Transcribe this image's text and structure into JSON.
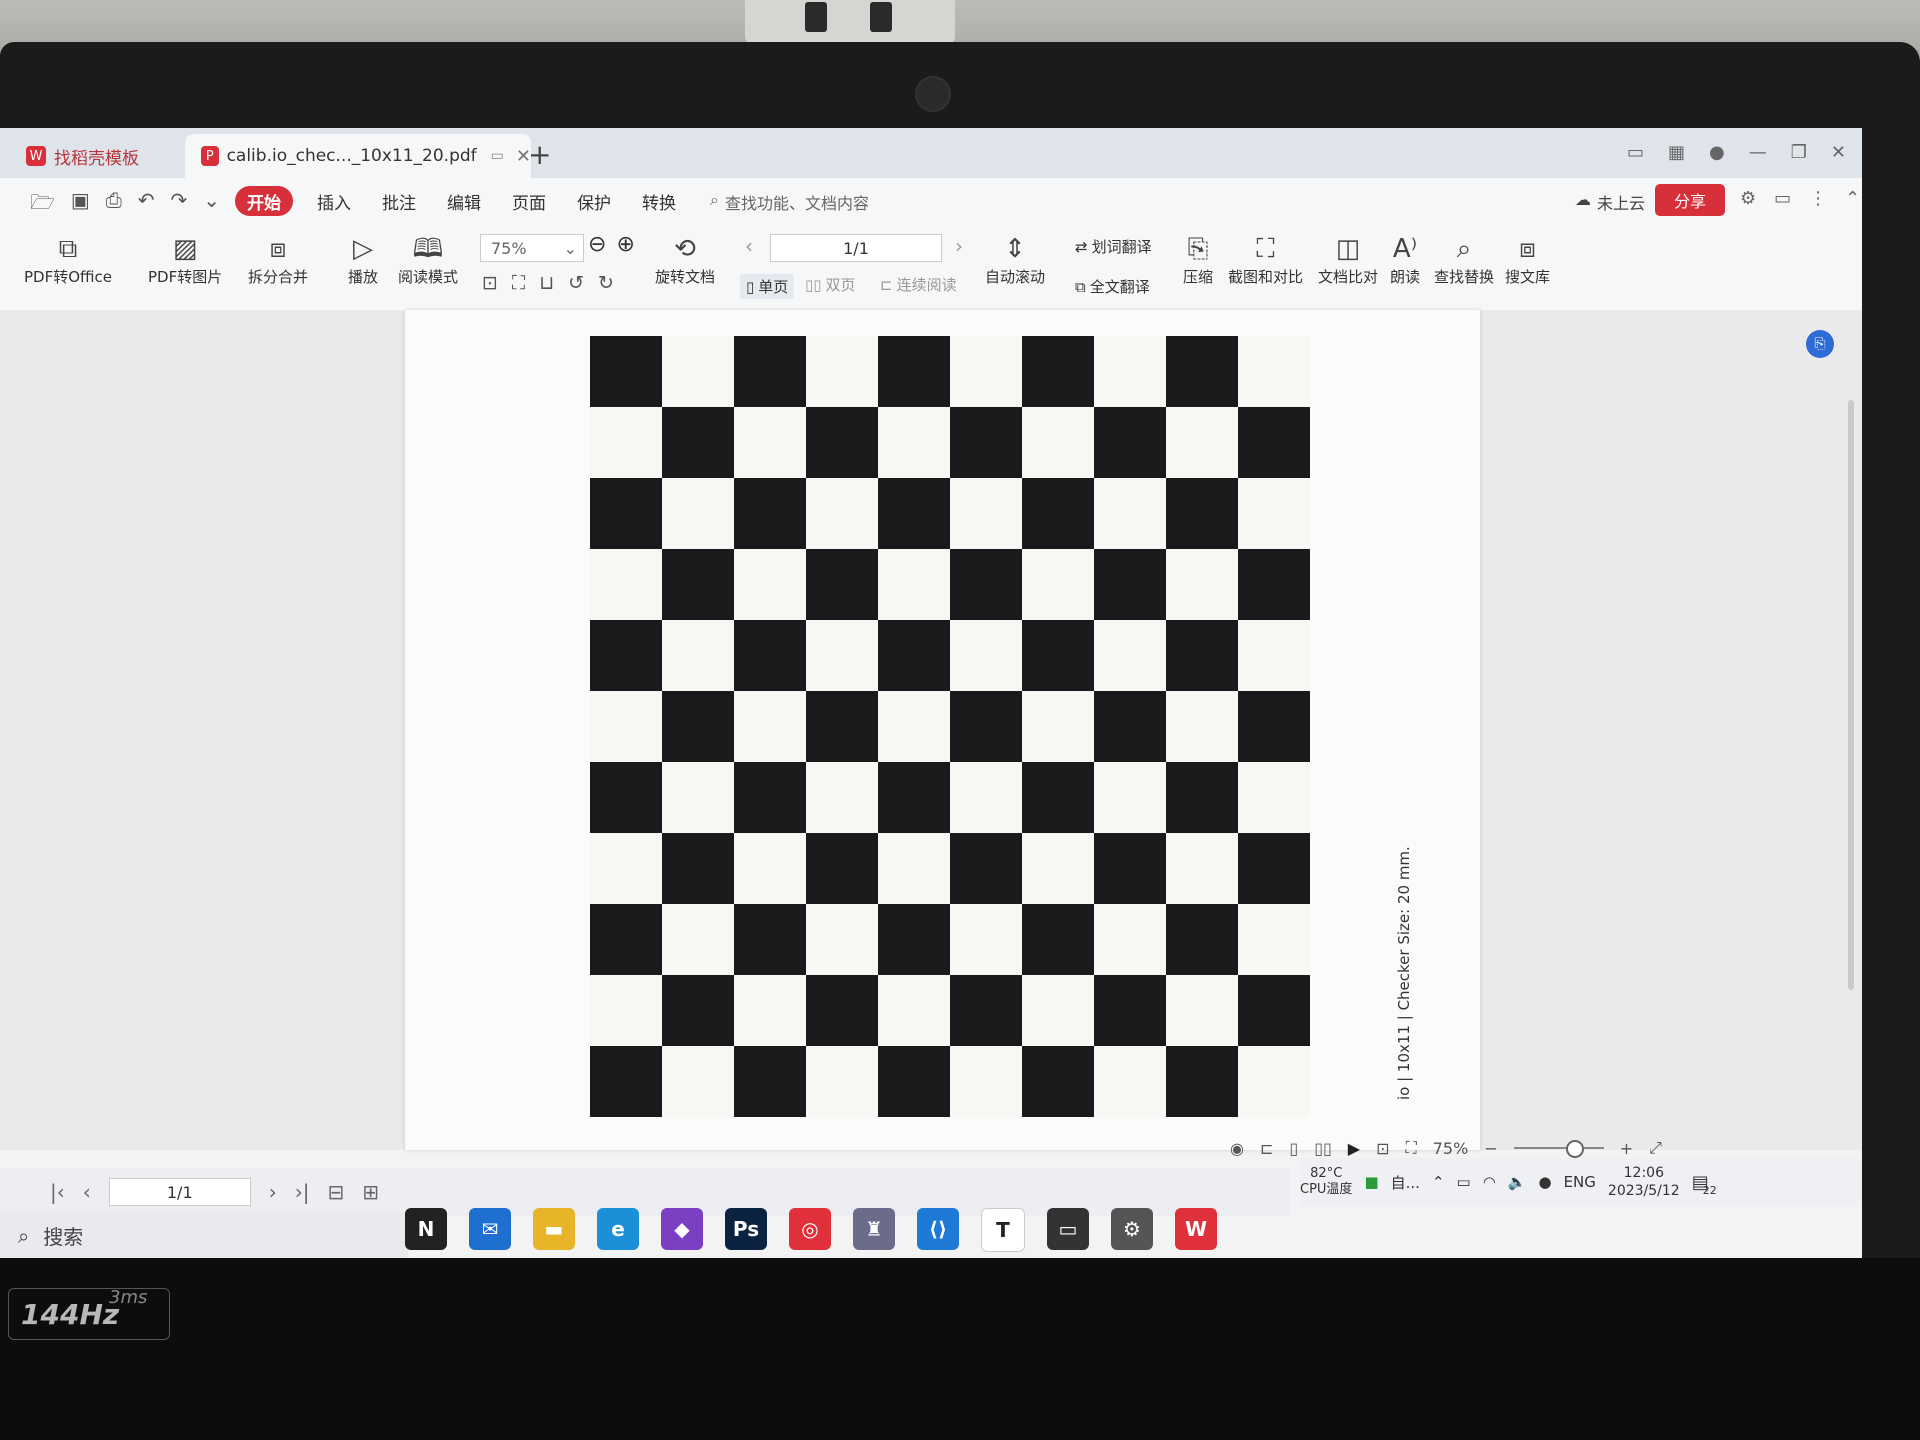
{
  "tabs": {
    "inactive": "找稻壳模板",
    "active": "calib.io_chec..._10x11_20.pdf",
    "add": "+"
  },
  "menu": {
    "items": [
      "开始",
      "插入",
      "批注",
      "编辑",
      "页面",
      "保护",
      "转换"
    ],
    "active": "开始",
    "search_placeholder": "查找功能、文档内容",
    "cloud_label": "未上云",
    "share_label": "分享"
  },
  "ribbon": {
    "pdf_to_office": "PDF转Office",
    "pdf_to_image": "PDF转图片",
    "split_merge": "拆分合并",
    "play": "播放",
    "read_mode": "阅读模式",
    "zoom": "75%",
    "page_indicator": "1/1",
    "rotate_doc": "旋转文档",
    "single_page": "单页",
    "double_page": "双页",
    "continuous_read": "连续阅读",
    "auto_scroll": "自动滚动",
    "word_translate": "划词翻译",
    "full_translate": "全文翻译",
    "compress": "压缩",
    "screenshot_compare": "截图和对比",
    "doc_compare": "文档比对",
    "read_aloud": "朗读",
    "find_replace": "查找替换",
    "search_library": "搜文库"
  },
  "document": {
    "board_rows": 11,
    "board_cols": 10,
    "side_caption": "io | 10x11 | Checker Size: 20 mm."
  },
  "status": {
    "zoom": "75%"
  },
  "pager": {
    "page": "1/1"
  },
  "taskbar": {
    "search_label": "搜索",
    "cpu_temp": "82°C",
    "cpu_label": "CPU温度",
    "app_status": "自...",
    "lang": "ENG",
    "time": "12:06",
    "date": "2023/5/12",
    "notifications": "22"
  },
  "apps": [
    {
      "name": "notion",
      "glyph": "N",
      "color": "#222222"
    },
    {
      "name": "mail",
      "glyph": "✉",
      "color": "#1f6fd1"
    },
    {
      "name": "file-explorer",
      "glyph": "▬",
      "color": "#e8b52a"
    },
    {
      "name": "edge",
      "glyph": "e",
      "color": "#1b8fd8"
    },
    {
      "name": "visual-studio",
      "glyph": "◆",
      "color": "#7b3fc4"
    },
    {
      "name": "photoshop",
      "glyph": "Ps",
      "color": "#0b2340"
    },
    {
      "name": "netease-music",
      "glyph": "◎",
      "color": "#e0313a"
    },
    {
      "name": "game",
      "glyph": "♜",
      "color": "#6b6b8a"
    },
    {
      "name": "vscode",
      "glyph": "⟨⟩",
      "color": "#1e7ad6"
    },
    {
      "name": "typora",
      "glyph": "T",
      "color": "#ffffff"
    },
    {
      "name": "terminal",
      "glyph": "▭",
      "color": "#333333"
    },
    {
      "name": "settings",
      "glyph": "⚙",
      "color": "#555555"
    },
    {
      "name": "wps",
      "glyph": "W",
      "color": "#e0313a"
    }
  ],
  "hardware": {
    "refresh_badge": "144Hz",
    "response_badge": "3ms"
  },
  "colors": {
    "accent": "#d8303a",
    "board_dark": "#1a1a1c"
  }
}
